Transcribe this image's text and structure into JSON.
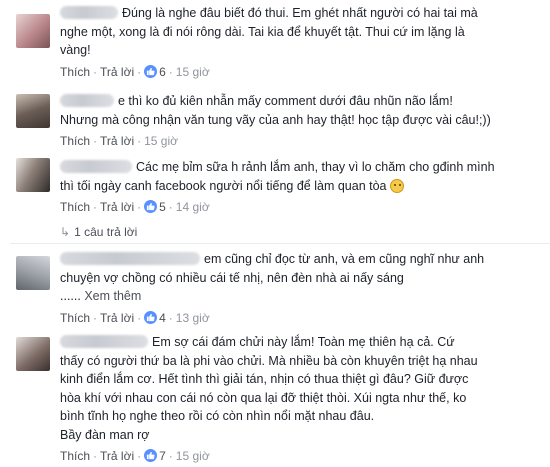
{
  "comments": [
    {
      "text_lines": [
        "Đúng là nghe đâu biết đó thui. Em ghét nhất người có hai tai mà",
        "nghe một, xong là đi nói rông dài. Tai kia để khuyết tật. Thui cứ im lặng là",
        "vàng!"
      ],
      "like_label": "Thích",
      "reply_label": "Trả lời",
      "like_count": "6",
      "time": "15 giờ",
      "avatar_color": "#b9868a"
    },
    {
      "text_lines": [
        "e thì ko đủ kiên nhẫn mấy comment dưới đâu nhũn não lắm!",
        "Nhưng mà công nhận văn tung vãy của anh hay thật! học tập được vài câu!;))"
      ],
      "like_label": "Thích",
      "reply_label": "Trả lời",
      "time": "15 giờ",
      "avatar_color": "#6b5e57"
    },
    {
      "text_lines": [
        "Các mẹ bỉm sữa h rảnh lắm anh, thay vì lo chăm cho gđinh mình",
        "thì tối ngày canh facebook người nổi tiếng để làm quan tòa"
      ],
      "like_label": "Thích",
      "reply_label": "Trả lời",
      "like_count": "5",
      "time": "14 giờ",
      "replies_label": "1 câu trả lời",
      "avatar_color": "#8c7f78"
    },
    {
      "text_lines": [
        "em cũng chỉ đọc từ anh, và em cũng nghĩ như anh",
        "chuyện vợ chồng có nhiều cái tế nhị, nên đèn nhà ai nấy sáng",
        "...... Xem thêm"
      ],
      "see_more_label": "Xem thêm",
      "like_label": "Thích",
      "reply_label": "Trả lời",
      "like_count": "4",
      "time": "13 giờ",
      "avatar_color": "#9da1a8"
    },
    {
      "text_lines": [
        "Em sợ cái đám chửi này lắm! Toàn mẹ thiên hạ cả. Cứ",
        "thấy có người thứ ba là phi vào chửi. Mà nhiều bà còn khuyên triệt hạ nhau",
        "kinh điển lắm cơ. Hết tình thì giải tán, nhịn có thua thiệt gì đâu? Giữ được",
        "hòa khí với nhau con cái nó còn qua lại đỡ thiệt thòi. Xúi ngta như thế, ko",
        "bình tĩnh họ nghe theo rồi có còn nhìn nổi mặt nhau đâu.",
        "Bầy đàn man rợ"
      ],
      "like_label": "Thích",
      "reply_label": "Trả lời",
      "like_count": "7",
      "time": "15 giờ",
      "avatar_color": "#7e6c66"
    }
  ]
}
